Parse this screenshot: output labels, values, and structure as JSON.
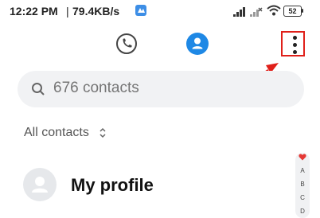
{
  "status_bar": {
    "time": "12:22 PM",
    "separator": "|",
    "speed": "79.4KB/s",
    "battery": "52"
  },
  "tabs": {
    "phone_icon": "phone-icon",
    "contacts_icon": "person-icon"
  },
  "search": {
    "placeholder": "676 contacts"
  },
  "filter": {
    "label": "All contacts"
  },
  "profile": {
    "name": "My profile"
  },
  "alphabet_index": [
    "A",
    "B",
    "C",
    "D"
  ],
  "colors": {
    "accent": "#1e88e5",
    "annotation": "#e0201a",
    "search_bg": "#f1f2f4"
  }
}
